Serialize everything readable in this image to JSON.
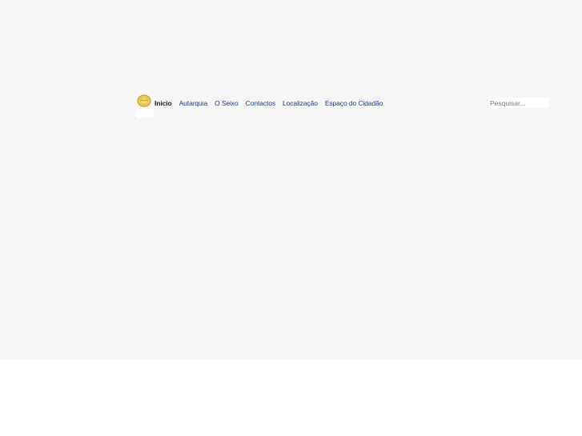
{
  "nav": {
    "items": [
      {
        "label": "Inicio",
        "active": true
      },
      {
        "label": "Autarquia",
        "active": false
      },
      {
        "label": "O Seixo",
        "active": false
      },
      {
        "label": "Contactos",
        "active": false
      },
      {
        "label": "Localização",
        "active": false
      },
      {
        "label": "Espaço do Cidadão",
        "active": false
      }
    ]
  },
  "search": {
    "placeholder": "Pesquisar..."
  },
  "logo": {
    "icon": "crest-logo-icon",
    "color": "#e8b92a"
  },
  "colors": {
    "background": "#f6f6f7",
    "nav_link": "#1d3a8a",
    "nav_active": "#1a1a1a"
  }
}
